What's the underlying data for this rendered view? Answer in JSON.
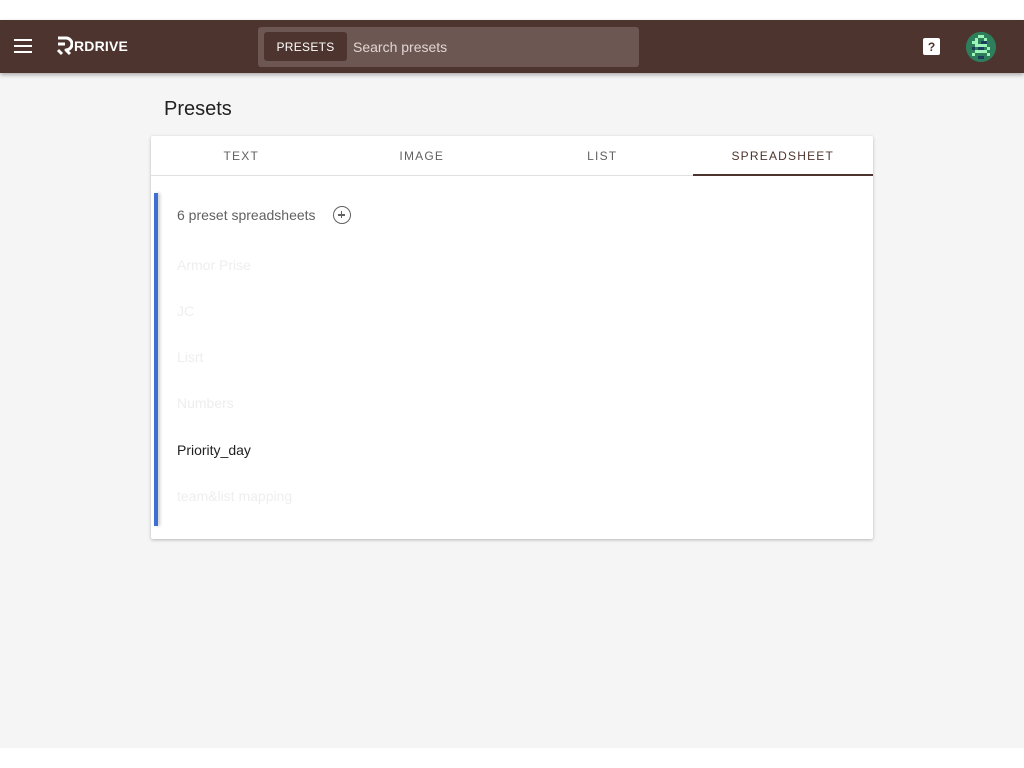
{
  "app": {
    "logo_text": "RDRIVE"
  },
  "search": {
    "chip_label": "PRESETS",
    "placeholder": "Search presets"
  },
  "header": {
    "help_label": "?"
  },
  "page": {
    "title": "Presets"
  },
  "tabs": [
    {
      "label": "TEXT",
      "active": false
    },
    {
      "label": "IMAGE",
      "active": false
    },
    {
      "label": "LIST",
      "active": false
    },
    {
      "label": "SPREADSHEET",
      "active": true
    }
  ],
  "spreadsheets": {
    "count_text": "6 preset spreadsheets",
    "items": [
      {
        "label": "Armor Prise",
        "active": false
      },
      {
        "label": "JC",
        "active": false
      },
      {
        "label": "Lisrt",
        "active": false
      },
      {
        "label": "Numbers",
        "active": false
      },
      {
        "label": "Priority_day",
        "active": true
      },
      {
        "label": "team&list mapping",
        "active": false
      }
    ]
  },
  "colors": {
    "topbar": "#4e342e",
    "accent_bar": "#3f6fd1"
  },
  "icons": [
    "menu-icon",
    "rdrive-logo-icon",
    "help-icon",
    "avatar-icon",
    "add-circle-icon"
  ]
}
